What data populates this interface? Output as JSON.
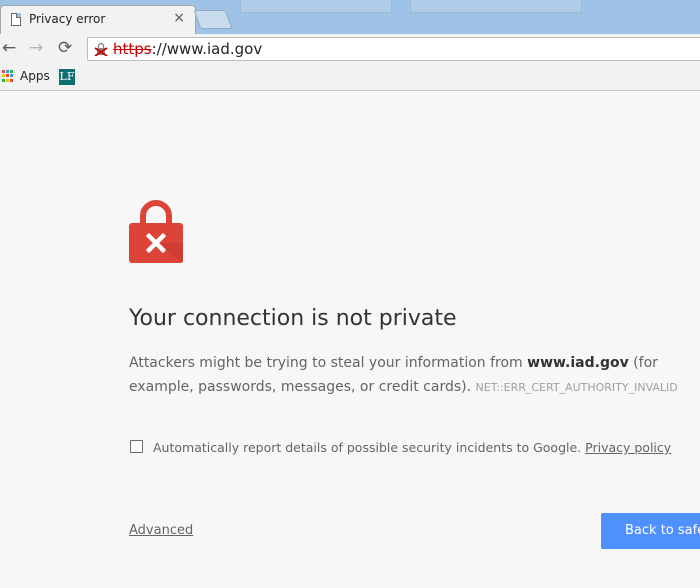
{
  "browser": {
    "tab": {
      "title": "Privacy error",
      "close": "×"
    },
    "nav": {
      "back": "←",
      "forward": "→",
      "reload": "⟳"
    },
    "omnibox": {
      "scheme": "https",
      "rest": "://www.iad.gov"
    },
    "bookmarks": {
      "apps_label": "Apps",
      "favicon_text": "LF"
    }
  },
  "interstitial": {
    "heading": "Your connection is not private",
    "desc_part1": "Attackers might be trying to steal your information from ",
    "domain": "www.iad.gov",
    "desc_part2": " (for example, passwords, messages, or credit cards).",
    "error_code": "NET::ERR_CERT_AUTHORITY_INVALID",
    "checkbox_text": "Automatically report details of possible security incidents to Google.",
    "privacy_link": "Privacy policy",
    "advanced_link": "Advanced",
    "back_button": "Back to safety"
  },
  "colors": {
    "accent": "#4d90fe",
    "lock_red": "#db4437",
    "tab_strip": "#9fc3e7"
  }
}
